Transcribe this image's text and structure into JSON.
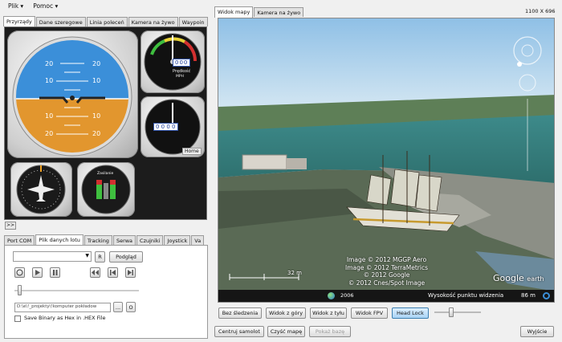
{
  "menu": {
    "items": [
      {
        "label": "Plik"
      },
      {
        "label": "Pomoc"
      }
    ]
  },
  "resolution": "1100 X 696",
  "left_tabs": [
    "Przyrządy",
    "Dane szeregowe",
    "Linia poleceń",
    "Kamera na żywo",
    "Waypoin"
  ],
  "instruments": {
    "horizon_ticks": [
      "20",
      "10",
      "10",
      "20"
    ],
    "speed_label": "Prędkość",
    "speed_unit": "MPH",
    "speed_value": "000",
    "altimeter_value": "0 0 0 0",
    "home_label": "Home",
    "zasilanie_label": "Zasilanie"
  },
  "expand_label": ">>",
  "bottom_tabs": [
    "Port COM",
    "Plik danych lotu",
    "Tracking",
    "Serwa",
    "Czujniki",
    "Joystick",
    "Va"
  ],
  "flight_file": {
    "r_label": "R",
    "preview_label": "Podgląd",
    "path": "D:\\e\\!_projekty\\!komputer pokładow",
    "browse_label": "...",
    "o_label": "O",
    "save_binary_label": "Save Binary as Hex in .HEX File"
  },
  "right_tabs": [
    "Widok mapy",
    "Kamera na żywo"
  ],
  "map": {
    "attribution": [
      "Image © 2012 MGGP Aero",
      "Image © 2012 TerraMetrics",
      "© 2012 Google",
      "© 2012 Cnes/Spot Image"
    ],
    "scale_label": "32 m",
    "year": "2006",
    "eye_alt_label": "Wysokość punktu widzenia",
    "eye_alt_value": "86 m",
    "logo_google": "Google",
    "logo_earth": "earth"
  },
  "view_buttons": [
    "Bez śledzenia",
    "Widok z góry",
    "Widok z tyłu",
    "Widok FPV",
    "Head Lock"
  ],
  "bottom_buttons": {
    "center": "Centruj samolot",
    "clear": "Czyść mapę",
    "show": "Pokaż bazę",
    "exit": "Wyjście"
  },
  "colors": {
    "sky": "#3b8fd9",
    "ground": "#e2962e",
    "panel_bg": "#1c1c1c",
    "accent": "#3c7fb1"
  }
}
